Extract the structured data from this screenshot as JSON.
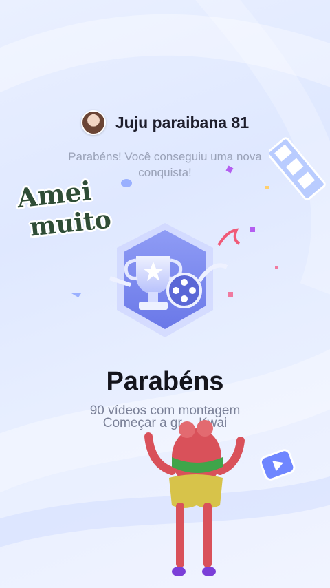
{
  "header": {
    "username": "Juju paraibana 81",
    "subtitle": "Parabéns! Você conseguiu uma nova conquista!"
  },
  "sticker": {
    "line1": "Amei",
    "line2": "muito"
  },
  "achievement": {
    "title": "Parabéns",
    "description": "90 vídeos com montagem",
    "cta": "Começar a gr…  Kwai"
  },
  "icons": {
    "badge": "trophy-badge-icon",
    "film": "film-reel-icon",
    "play": "play-icon",
    "film_strip": "film-strip-icon"
  },
  "colors": {
    "background": "#e4ecff",
    "badge": "#7d8cf0",
    "sticker_text": "#2f4d36",
    "character": "#d9515a"
  }
}
